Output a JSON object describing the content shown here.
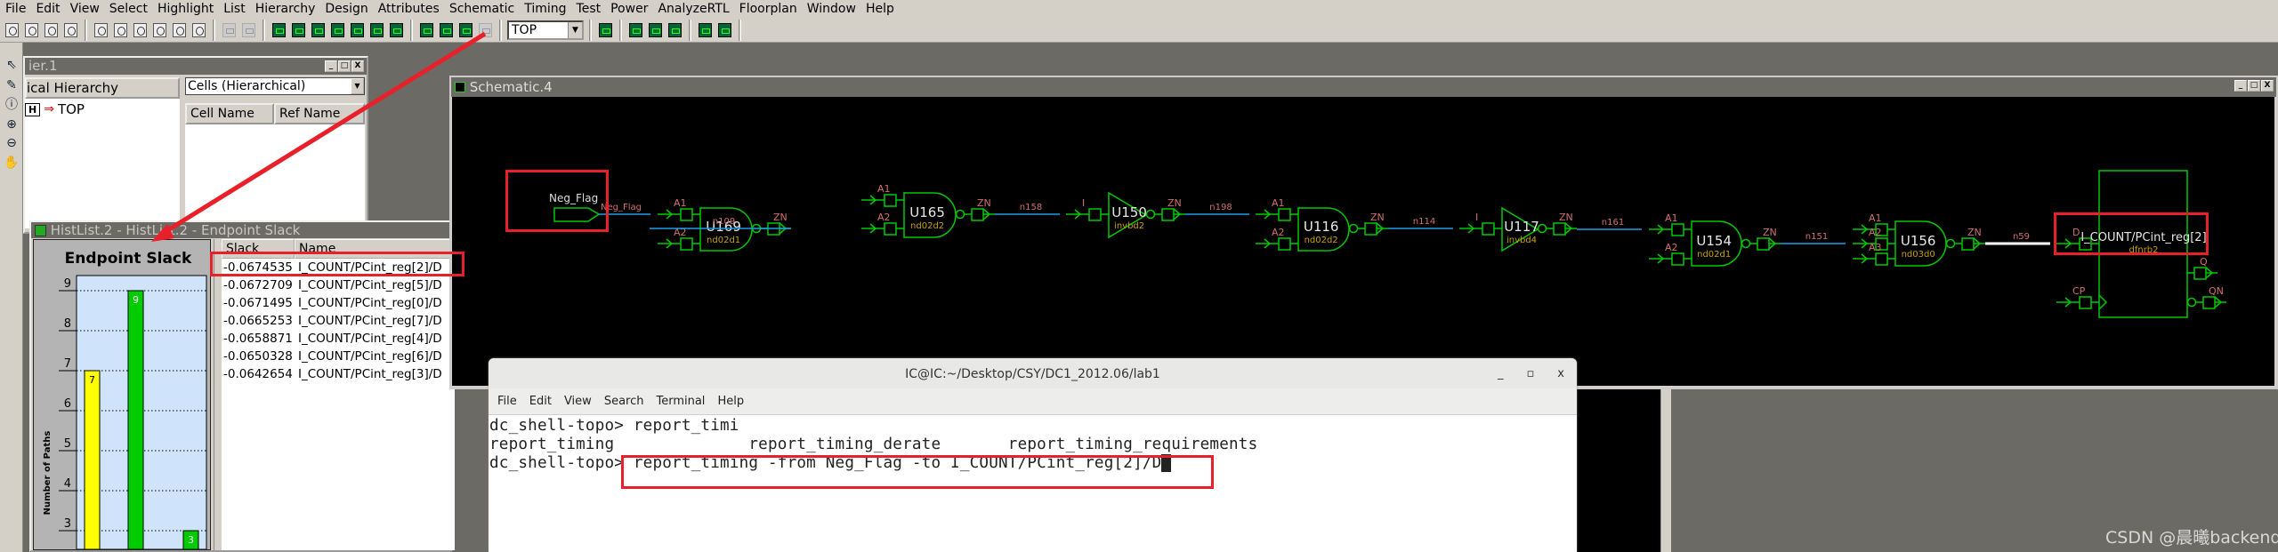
{
  "menu": [
    "File",
    "Edit",
    "View",
    "Select",
    "Highlight",
    "List",
    "Hierarchy",
    "Design",
    "Attributes",
    "Schematic",
    "Timing",
    "Test",
    "Power",
    "AnalyzeRTL",
    "Floorplan",
    "Window",
    "Help"
  ],
  "toolbar": {
    "groups": [
      [
        "open-folder-icon",
        "save-icon",
        "print-icon",
        "properties-icon"
      ],
      [
        "zoom-fit-icon",
        "zoom-2x-icon",
        "zoom-half-icon",
        "hand-zoom-icon",
        "zoom-box-icon",
        "select-box-icon"
      ],
      [
        "move-down-icon",
        "move-up-icon"
      ],
      [
        "new-schematic-icon",
        "schematic-cell-icon",
        "schematic-design-icon",
        "schematic-path-icon",
        "schematic-fanin-icon",
        "schematic-fanout-icon",
        "schematic-fan-icon"
      ],
      [
        "endpoint-slack-histogram-icon",
        "path-slack-histogram-icon",
        "net-capacitance-histogram-icon",
        "disabled-histogram-icon"
      ]
    ],
    "design_select": "TOP",
    "groups_after": [
      [
        "hierarchy-browser-icon"
      ],
      [
        "layout-view-icon",
        "timing-view-icon",
        "check-icon"
      ],
      [
        "back-icon",
        "forward-icon"
      ]
    ]
  },
  "left_tools": [
    "pointer-icon",
    "pencil-icon",
    "info-icon",
    "zoom-in-icon",
    "zoom-out-icon",
    "pan-hand-icon"
  ],
  "hierarchy_window": {
    "title": "ier.1",
    "tree_header": "ical Hierarchy",
    "tree_items": [
      {
        "badge": "H",
        "label": "TOP"
      }
    ],
    "cells_dropdown": "Cells (Hierarchical)",
    "columns": [
      "Cell Name",
      "Ref Name"
    ]
  },
  "histlist_window": {
    "title": "HistList.2 - HistList.2 - Endpoint Slack",
    "table": {
      "columns": [
        "Slack",
        "Name"
      ],
      "rows": [
        [
          "-0.0674535",
          "I_COUNT/PCint_reg[2]/D"
        ],
        [
          "-0.0672709",
          "I_COUNT/PCint_reg[5]/D"
        ],
        [
          "-0.0671495",
          "I_COUNT/PCint_reg[0]/D"
        ],
        [
          "-0.0665253",
          "I_COUNT/PCint_reg[7]/D"
        ],
        [
          "-0.0658871",
          "I_COUNT/PCint_reg[4]/D"
        ],
        [
          "-0.0650328",
          "I_COUNT/PCint_reg[6]/D"
        ],
        [
          "-0.0642654",
          "I_COUNT/PCint_reg[3]/D"
        ]
      ]
    }
  },
  "chart_data": {
    "type": "bar",
    "title": "Endpoint Slack",
    "ylabel": "Number of Paths",
    "xlabel": "",
    "values": [
      7,
      9,
      3
    ],
    "colors": [
      "#ffff00",
      "#00cc00",
      "#00cc00"
    ],
    "yticks": [
      3,
      4,
      5,
      6,
      7,
      8,
      9
    ],
    "grid": true,
    "plot_background": "#cfe4fb"
  },
  "schematic": {
    "title": "Schematic.4",
    "port": {
      "name": "Neg_Flag",
      "net": "Neg_Flag"
    },
    "gates": [
      {
        "id": "U169",
        "ref": "nd02d1",
        "inputs": [
          "A1",
          "A2"
        ],
        "output": "ZN"
      },
      {
        "id": "U165",
        "ref": "nd02d2",
        "inputs": [
          "A1",
          "A2"
        ],
        "output": "ZN"
      },
      {
        "id": "U150",
        "ref": "invbd2",
        "inputs": [
          "I"
        ],
        "output": "ZN"
      },
      {
        "id": "U116",
        "ref": "nd02d2",
        "inputs": [
          "A1",
          "A2"
        ],
        "output": "ZN"
      },
      {
        "id": "U117",
        "ref": "invbd4",
        "inputs": [
          "I"
        ],
        "output": "ZN"
      },
      {
        "id": "U154",
        "ref": "nd02d1",
        "inputs": [
          "A1",
          "A2"
        ],
        "output": "ZN"
      },
      {
        "id": "U156",
        "ref": "nd03d0",
        "inputs": [
          "A1",
          "A2",
          "A3"
        ],
        "output": "ZN"
      }
    ],
    "nets": [
      "n109",
      "n158",
      "n198",
      "n114",
      "n161",
      "n151",
      "n59"
    ],
    "flop": {
      "name": "I_COUNT/PCint_reg[2]",
      "ref": "dfnrb2",
      "pins": [
        "D",
        "CP",
        "Q",
        "QN"
      ]
    },
    "colors": {
      "cell": "#00c800",
      "net": "#1e9ee8",
      "highlight_net": "#ffffff",
      "pin_label": "#d07070",
      "ref_label": "#c8a000"
    }
  },
  "terminal": {
    "title": "IC@IC:~/Desktop/CSY/DC1_2012.06/lab1",
    "menu": [
      "File",
      "Edit",
      "View",
      "Search",
      "Terminal",
      "Help"
    ],
    "lines": [
      "dc_shell-topo> report_timi",
      "report_timing              report_timing_derate       report_timing_requirements"
    ],
    "prompt": "dc_shell-topo> ",
    "command": "report_timing -from Neg_Flag -to I_COUNT/PCint_reg[2]/D"
  },
  "annotation_color": "#e8202a",
  "watermark": "CSDN @晨曦backend"
}
